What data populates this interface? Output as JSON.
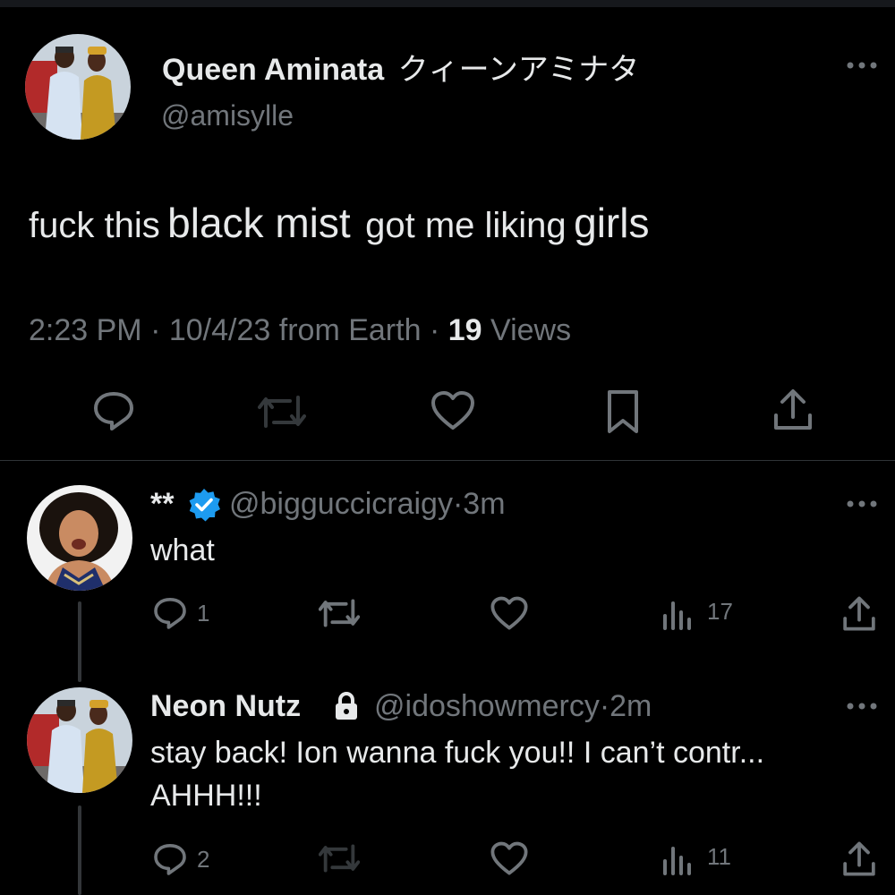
{
  "main_tweet": {
    "display_name": "Queen Aminata",
    "display_name_jp": "クィーンアミナタ",
    "handle": "@amisylle",
    "text_parts": [
      "fuck this",
      "black mist",
      "got me liking",
      "girls"
    ],
    "time": "2:23 PM",
    "date": "10/4/23",
    "source": "from Earth",
    "views_count": "19",
    "views_label": "Views",
    "separator": "·"
  },
  "replies": [
    {
      "display_name": "**",
      "verified": true,
      "handle": "@bigguccicraigy",
      "age": "3m",
      "text": "what",
      "reply_count": "1",
      "view_count": "17"
    },
    {
      "display_name": "Neon Nutz",
      "locked": true,
      "handle": "@idoshowmercy",
      "age": "2m",
      "text_line1": "stay back! Ion wanna fuck you!! I can’t contr...",
      "text_line2": "AHHH!!!",
      "reply_count": "2",
      "view_count": "11"
    }
  ],
  "colors": {
    "background": "#000000",
    "text": "#e7e9ea",
    "secondary": "#71767b",
    "verified": "#1d9bf0",
    "divider": "#2f3336"
  },
  "icons": [
    "reply-icon",
    "retweet-icon",
    "like-icon",
    "bookmark-icon",
    "share-icon",
    "views-icon",
    "more-icon",
    "verified-icon",
    "lock-icon"
  ]
}
